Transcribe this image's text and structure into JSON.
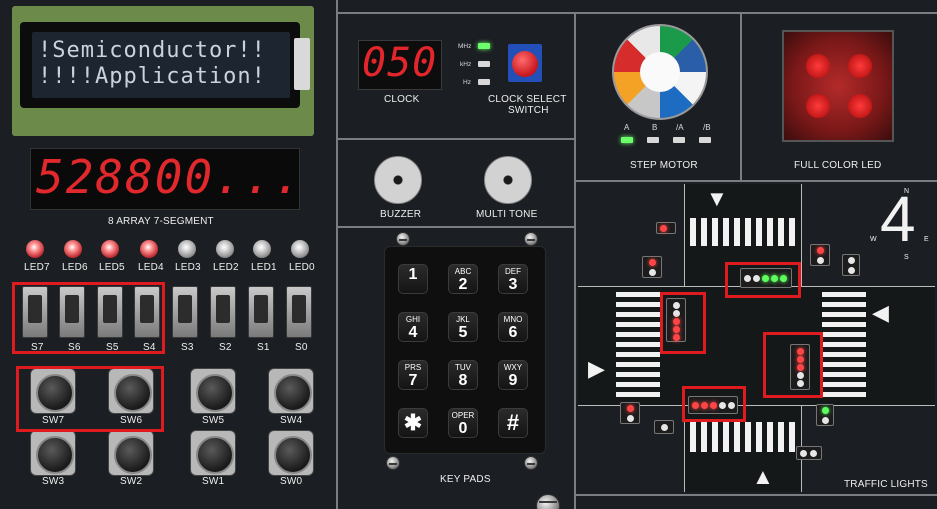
{
  "lcd": {
    "line1": "!Semiconductor!!",
    "line2": "!!!!Application!"
  },
  "seven_segment": {
    "display": "528800...",
    "label": "8 ARRAY 7-SEGMENT"
  },
  "leds": [
    "LED7",
    "LED6",
    "LED5",
    "LED4",
    "LED3",
    "LED2",
    "LED1",
    "LED0"
  ],
  "toggle_switches": [
    "S7",
    "S6",
    "S5",
    "S4",
    "S3",
    "S2",
    "S1",
    "S0"
  ],
  "push_buttons": [
    "SW7",
    "SW6",
    "SW5",
    "SW4",
    "SW3",
    "SW2",
    "SW1",
    "SW0"
  ],
  "clock": {
    "display": "050",
    "label": "CLOCK",
    "units": [
      "MHz",
      "kHz",
      "Hz"
    ],
    "select_label_1": "CLOCK SELECT",
    "select_label_2": "SWITCH"
  },
  "buzzer": {
    "label": "BUZZER"
  },
  "multi_tone": {
    "label": "MULTI TONE"
  },
  "keypad": {
    "label": "KEY PADS",
    "keys": [
      {
        "top": "",
        "main": "1"
      },
      {
        "top": "ABC",
        "main": "2"
      },
      {
        "top": "DEF",
        "main": "3"
      },
      {
        "top": "GHI",
        "main": "4"
      },
      {
        "top": "JKL",
        "main": "5"
      },
      {
        "top": "MNO",
        "main": "6"
      },
      {
        "top": "PRS",
        "main": "7"
      },
      {
        "top": "TUV",
        "main": "8"
      },
      {
        "top": "WXY",
        "main": "9"
      },
      {
        "top": "",
        "main": "✱"
      },
      {
        "top": "OPER",
        "main": "0"
      },
      {
        "top": "",
        "main": "#"
      }
    ]
  },
  "step_motor": {
    "label": "STEP MOTOR",
    "phases": [
      "A",
      "B",
      "/A",
      "/B"
    ]
  },
  "full_color_led": {
    "label": "FULL COLOR LED"
  },
  "traffic_lights": {
    "label": "TRAFFIC LIGHTS",
    "compass": {
      "digit": "4",
      "n": "N",
      "e": "E",
      "s": "S",
      "w": "W"
    }
  },
  "colors": {
    "board": "#1b1e22",
    "segment_red": "#e1282c",
    "highlight": "#e01b1f",
    "divider": "#7a7e83"
  }
}
